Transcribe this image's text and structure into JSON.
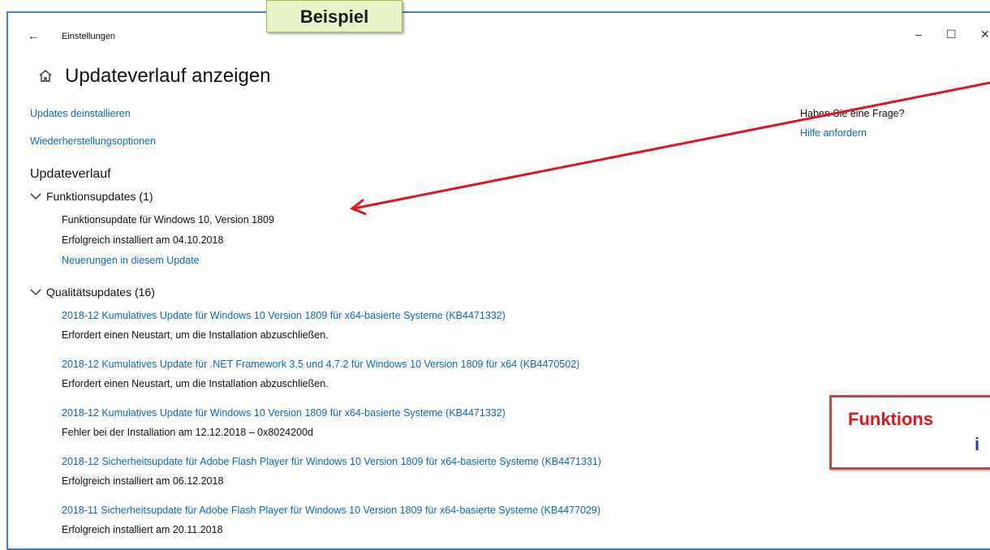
{
  "window": {
    "app_title": "Einstellungen",
    "back_icon": "back-arrow-icon",
    "minimize_glyph": "–",
    "maximize_glyph": "☐",
    "close_glyph": "✕"
  },
  "callout": {
    "label": "Beispiel"
  },
  "page": {
    "title": "Updateverlauf anzeigen",
    "home_icon": "home-icon"
  },
  "side_links": {
    "uninstall": "Updates deinstallieren",
    "recovery": "Wiederherstellungsoptionen"
  },
  "help": {
    "question": "Haben Sie eine Frage?",
    "link": "Hilfe anfordern"
  },
  "history": {
    "section_title": "Updateverlauf",
    "feature_group": {
      "label": "Funktionsupdates (1)",
      "items": [
        {
          "name": "Funktionsupdate für Windows 10, Version 1809",
          "status": "Erfolgreich installiert am 04.10.2018",
          "link": "Neuerungen in diesem Update"
        }
      ]
    },
    "quality_group": {
      "label": "Qualitätsupdates (16)",
      "items": [
        {
          "name": "2018-12 Kumulatives Update für Windows 10 Version 1809 für x64-basierte Systeme (KB4471332)",
          "status": "Erfordert einen Neustart, um die Installation abzuschließen."
        },
        {
          "name": "2018-12 Kumulatives Update für .NET Framework 3.5 und 4.7.2 für Windows 10 Version 1809 für x64 (KB4470502)",
          "status": "Erfordert einen Neustart, um die Installation abzuschließen."
        },
        {
          "name": "2018-12 Kumulatives Update für Windows 10 Version 1809 für x64-basierte Systeme (KB4471332)",
          "status": "Fehler bei der Installation am 12.12.2018 – 0x8024200d"
        },
        {
          "name": "2018-12 Sicherheitsupdate für Adobe Flash Player für Windows 10 Version 1809 für x64-basierte Systeme (KB4471331)",
          "status": "Erfolgreich installiert am 06.12.2018"
        },
        {
          "name": "2018-11 Sicherheitsupdate für Adobe Flash Player für Windows 10 Version 1809 für x64-basierte Systeme (KB4477029)",
          "status": "Erfolgreich installiert am 20.11.2018"
        }
      ]
    }
  },
  "annotation": {
    "line1": "Funktions",
    "line2": "i",
    "arrow_color": "#e0151d"
  }
}
